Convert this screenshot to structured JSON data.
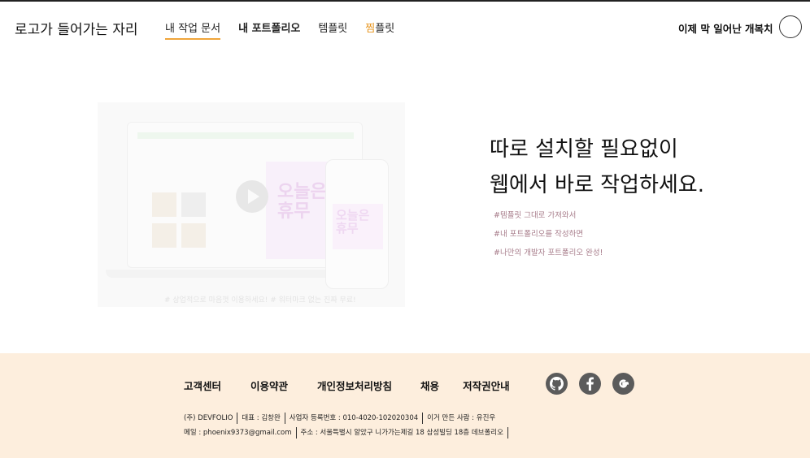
{
  "header": {
    "logo": "로고가 들어가는 자리",
    "nav": [
      {
        "label": "내 작업 문서"
      },
      {
        "label": "내 포트폴리오"
      },
      {
        "label": "템플릿"
      },
      {
        "accent": "찜",
        "label": "플릿"
      }
    ],
    "user_name": "이제 막 일어난 개복치"
  },
  "hero": {
    "media": {
      "poster_text": "오늘은\n휴무",
      "caption": "# 상업적으로 마음껏 이용하세요! # 워터마크 없는 진짜 무료!"
    },
    "title_line1": "따로 설치할 필요없이",
    "title_line2": "웹에서 바로 작업하세요.",
    "tags": [
      "#템플릿 그대로 가져와서",
      "#내 포트폴리오를 작성하면",
      "#나만의 개발자 포트폴리오 완성!"
    ]
  },
  "footer": {
    "links": [
      "고객센터",
      "이용약관",
      "개인정보처리방침",
      "채용",
      "저작권안내"
    ],
    "social": [
      "github-icon",
      "facebook-icon",
      "google-icon"
    ],
    "info_line1": [
      "(주) DEVFOLIO",
      "대표 : 김창완",
      "사업자 등록번호 : 010-4020-102020304",
      "이거 만든 사람 : 유진우"
    ],
    "info_line2": [
      "메일 : phoenix9373@gmail.com",
      "주소 : 서울특별시 알았구 니가가는제길 18 삼성빌딩 18층 데브폴리오"
    ],
    "colors": {
      "background": "#fdeedd",
      "accent": "#e7941c",
      "social": "#5b5b5b"
    }
  }
}
